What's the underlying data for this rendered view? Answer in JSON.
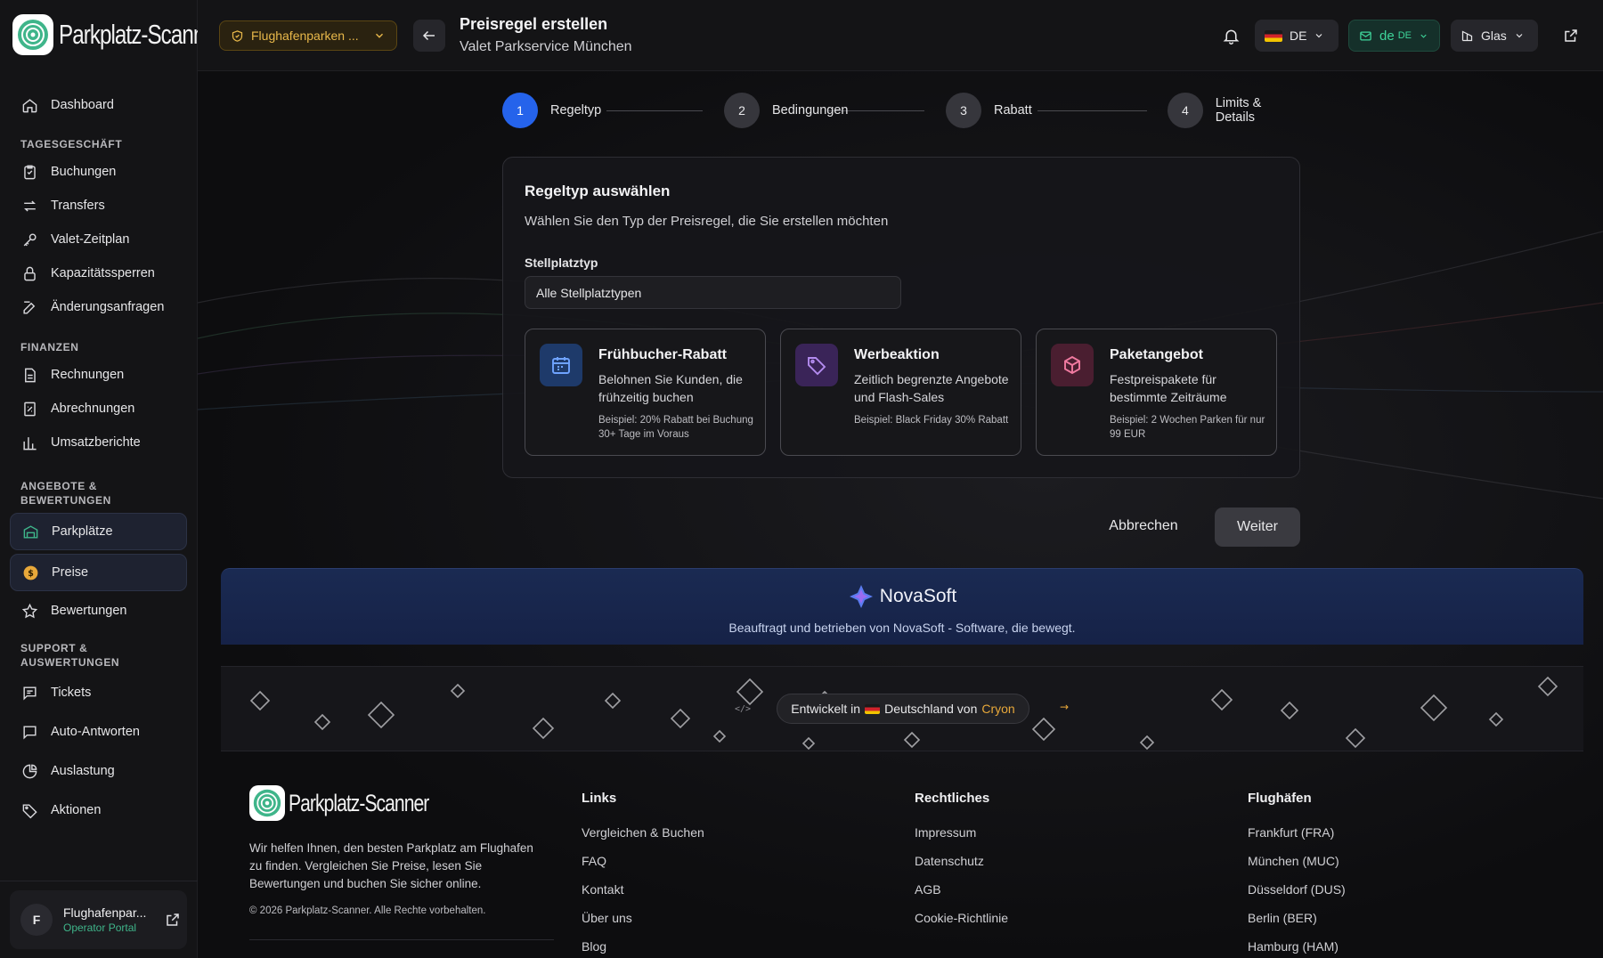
{
  "brand": {
    "name": "Parkplatz-Scanner"
  },
  "sidebar": {
    "dashboard": "Dashboard",
    "groups": {
      "tagesgeschaeft": "TAGESGESCHÄFT",
      "finanzen": "FINANZEN",
      "angebote_1": "ANGEBOTE &",
      "angebote_2": "BEWERTUNGEN",
      "support_1": "SUPPORT &",
      "support_2": "AUSWERTUNGEN"
    },
    "items": {
      "buchungen": "Buchungen",
      "transfers": "Transfers",
      "valet": "Valet-Zeitplan",
      "kapazitaet": "Kapazitätssperren",
      "aenderungen": "Änderungsanfragen",
      "rechnungen": "Rechnungen",
      "abrechnungen": "Abrechnungen",
      "umsatz": "Umsatzberichte",
      "parkplaetze": "Parkplätze",
      "preise": "Preise",
      "bewertungen": "Bewertungen",
      "tickets": "Tickets",
      "auto_antworten": "Auto-Antworten",
      "auslastung": "Auslastung",
      "aktionen": "Aktionen"
    },
    "user": {
      "initial": "F",
      "name": "Flughafenpar...",
      "role": "Operator Portal"
    }
  },
  "header": {
    "location": "Flughafenparken ...",
    "title": "Preisregel erstellen",
    "subtitle": "Valet Parkservice München",
    "lang": "DE",
    "mail_lang": "de",
    "mail_region": "DE",
    "theme": "Glas"
  },
  "stepper": {
    "steps": [
      {
        "num": "1",
        "label": "Regeltyp"
      },
      {
        "num": "2",
        "label": "Bedingungen"
      },
      {
        "num": "3",
        "label": "Rabatt"
      },
      {
        "num": "4",
        "label": "Limits & Details"
      }
    ]
  },
  "card": {
    "title": "Regeltyp auswählen",
    "description": "Wählen Sie den Typ der Preisregel, die Sie erstellen möchten",
    "field_label": "Stellplatztyp",
    "field_value": "Alle Stellplatztypen",
    "types": [
      {
        "title": "Frühbucher-Rabatt",
        "desc": "Belohnen Sie Kunden, die frühzeitig buchen",
        "example": "Beispiel: 20% Rabatt bei Buchung 30+ Tage im Voraus"
      },
      {
        "title": "Werbeaktion",
        "desc": "Zeitlich begrenzte Angebote und Flash-Sales",
        "example": "Beispiel: Black Friday 30% Rabatt"
      },
      {
        "title": "Paketangebot",
        "desc": "Festpreispakete für bestimmte Zeiträume",
        "example": "Beispiel: 2 Wochen Parken für nur 99 EUR"
      }
    ]
  },
  "actions": {
    "cancel": "Abbrechen",
    "next": "Weiter"
  },
  "banner": {
    "brand": "NovaSoft",
    "tagline": "Beauftragt und betrieben von NovaSoft - Software, die bewegt.",
    "dev_prefix": "Entwickelt in",
    "dev_country": "Deutschland von",
    "dev_company": "Cryon"
  },
  "footer": {
    "description": "Wir helfen Ihnen, den besten Parkplatz am Flughafen zu finden. Vergleichen Sie Preise, lesen Sie Bewertungen und buchen Sie sicher online.",
    "copyright": "© 2026 Parkplatz-Scanner. Alle Rechte vorbehalten.",
    "columns": [
      {
        "title": "Links",
        "items": [
          "Vergleichen & Buchen",
          "FAQ",
          "Kontakt",
          "Über uns",
          "Blog"
        ]
      },
      {
        "title": "Rechtliches",
        "items": [
          "Impressum",
          "Datenschutz",
          "AGB",
          "Cookie-Richtlinie"
        ]
      },
      {
        "title": "Flughäfen",
        "items": [
          "Frankfurt (FRA)",
          "München (MUC)",
          "Düsseldorf (DUS)",
          "Berlin (BER)",
          "Hamburg (HAM)"
        ]
      }
    ]
  },
  "colors": {
    "accent": "#2563eb",
    "brand_green": "#3fb58a",
    "location_amber": "#e8b84a",
    "novasoft_blue": "#1a2a52"
  }
}
